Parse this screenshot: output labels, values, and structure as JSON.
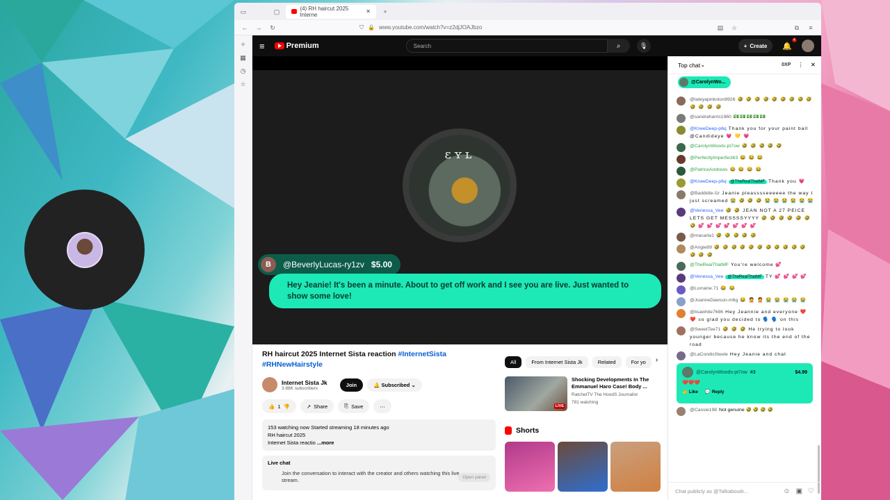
{
  "browser": {
    "tab_title": "(4) RH haircut 2025 Interne",
    "url": "www.youtube.com/watch?v=z2djJOAJbzo"
  },
  "header": {
    "brand": "Premium",
    "search_placeholder": "Search",
    "create_label": "Create",
    "notification_count": "4"
  },
  "player": {
    "superchat": {
      "avatar_letter": "B",
      "name": "@BeverlyLucas-ry1zv",
      "amount": "$5.00",
      "message": "Hey Jeanie! It's been a minute. About to get off work and I see you are live. Just wanted to show some love!"
    },
    "channel_art_text": "ɛʏʟ"
  },
  "video": {
    "title_plain": "RH haircut 2025 Internet Sista reaction ",
    "tag1": "#InternetSista",
    "tag2": "#RHNewHairstyle",
    "channel_name": "Internet Sista Jk",
    "subscribers": "3.88K subscribers",
    "join_label": "Join",
    "subscribed_label": "Subscribed",
    "likes": "1",
    "share_label": "Share",
    "save_label": "Save",
    "desc_stats": "153 watching now  Started streaming 18 minutes ago",
    "desc_line1": "RH haircut 2025",
    "desc_line2": "Internet Sista reactio",
    "desc_more": "...more",
    "livechat_title": "Live chat",
    "livechat_text": "Join the conversation to interact with the creator and others watching this live stream.",
    "open_panel": "Open panel"
  },
  "related": {
    "chips": [
      "All",
      "From Internet Sista Jk",
      "Related",
      "For yo"
    ],
    "item": {
      "title": "Shocking Developments In The Emmanuel Haro Case! Body ...",
      "channel": "RatchetTV The HoodS Journalist",
      "meta": "781 watching",
      "live_badge": "LIVE"
    },
    "shorts_title": "Shorts"
  },
  "chat": {
    "mode": "Top chat",
    "xp": "0XP",
    "pinned_name": "@CarolynWo...",
    "messages": [
      {
        "name": "@lateyapinkston8926",
        "text": "🤣 🤣 🤣 🤣 🤣 🤣 🤣 🤣 🤣 🤣 🤣 🤣 🤣",
        "cls": ""
      },
      {
        "name": "@sandraharris1960",
        "text": "💵💵💵💵💵",
        "cls": ""
      },
      {
        "name": "@KneeDeep-p6q",
        "text": "Thank you for your paint ball @Candideye 💗 💛 💗",
        "cls": "mod"
      },
      {
        "name": "@CarolynWoods-pt7ow",
        "text": "🤣 🤣 🤣 🤣 🤣",
        "cls": "mem"
      },
      {
        "name": "@PerfectlyImperfect63",
        "text": "😂 😂 😂",
        "cls": "mem"
      },
      {
        "name": "@PatriceAndrews",
        "text": "😂 😂 😂 😂",
        "cls": "mem"
      },
      {
        "name": "@KneeDeep-p6q",
        "text": "Thank you 💗",
        "cls": "mod",
        "chip": "@TheRealThatMF"
      },
      {
        "name": "@Baddidle-l1r",
        "text": "Jeanie pleasssseeeeee the way I just screamed 😭 🤣 🤣 🤣 😭 😭 😭 😭 😭 😭",
        "cls": ""
      },
      {
        "name": "@Venessa_Vee",
        "text": "🤣 🤣 JEAN NOT A 27 PEICE LETS GET MESSSSYYYY 🤣 🤣 🤣 🤣 🤣 🤣 🤣 💕 💕 💕 💕 💕 💕 💕",
        "cls": "mod"
      },
      {
        "name": "@macarla1",
        "text": "🤣 🤣 🤣 🤣 🤣",
        "cls": ""
      },
      {
        "name": "@Angie89",
        "text": "🤣 🤣 🤣 🤣 🤣 🤣 🤣 🤣 🤣 🤣 🤣 🤣 🤣 🤣",
        "cls": ""
      },
      {
        "name": "@TheRealThatMF",
        "text": "You're welcome 💕",
        "cls": "mem"
      },
      {
        "name": "@Venessa_Vee",
        "text": "TY 💕 💕 💕 💕",
        "cls": "mod",
        "chip": "@TheRealThatMF"
      },
      {
        "name": "@Lorraine.71",
        "text": "😂 😂",
        "cls": ""
      },
      {
        "name": "@JoanneDawson-m6g",
        "text": "😂 🤦 🤦 😭 😭 😭 😭 😭",
        "cls": ""
      },
      {
        "name": "@lisawhite7686",
        "text": "Hey Jeannie and everyone ❤️ ❤️ so glad you decided to 🗣️ 🗣️ on this",
        "cls": ""
      },
      {
        "name": "@SweetTee71",
        "text": "🤣 🤣 🤣 He trying to look younger because he know its the end of the road",
        "cls": ""
      },
      {
        "name": "@LaCondisSteele",
        "text": "Hey Jeanie and chat",
        "cls": ""
      }
    ],
    "sc_card": {
      "name": "@CarolynWoods-pt7ow",
      "badge": "#3",
      "amount": "$4.99",
      "text": "❤️❤️❤️",
      "like": "Like",
      "reply": "Reply"
    },
    "last_msg": {
      "name": "@Cassie198",
      "text": "Not genuine 🤣 🤣 🤣 🤣"
    },
    "input_placeholder": "Chat publicly as @Talkaboutit..."
  }
}
